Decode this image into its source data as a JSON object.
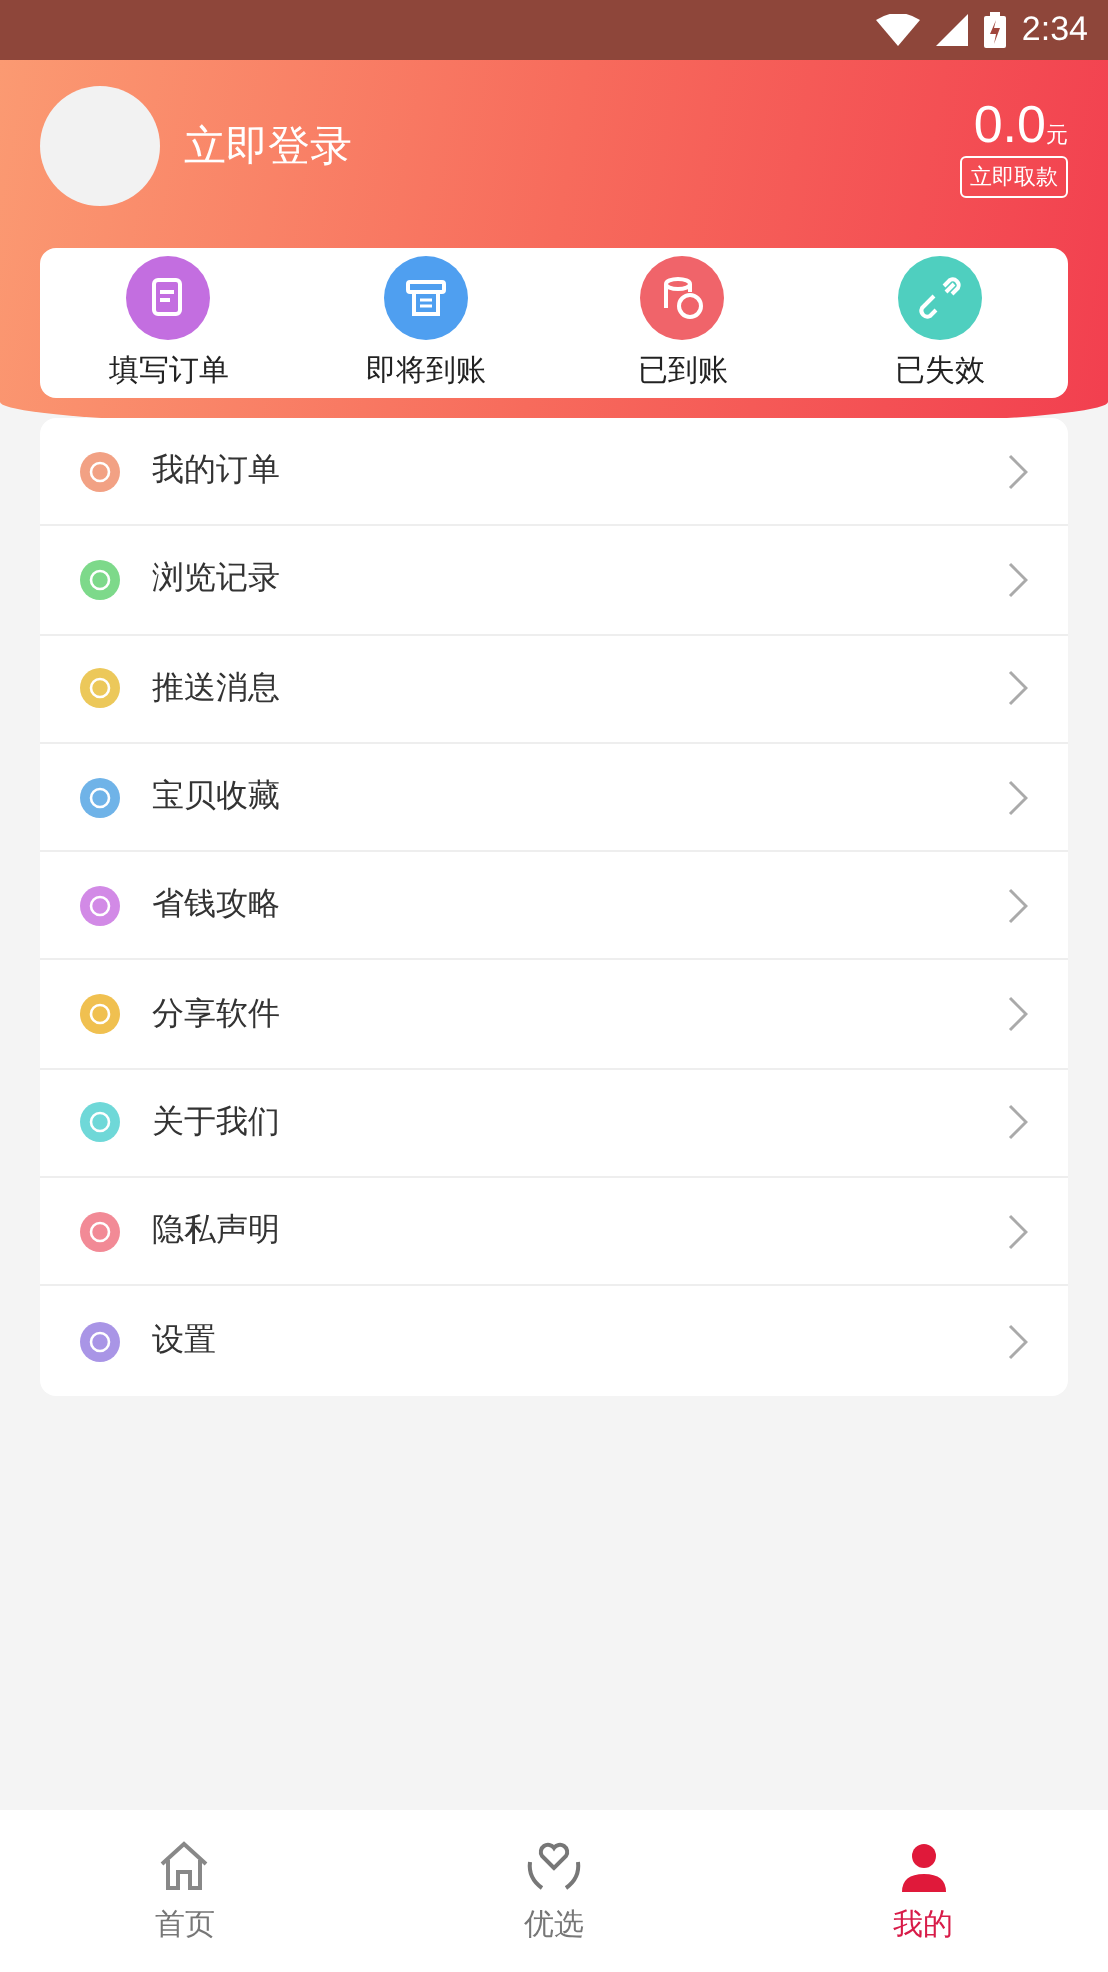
{
  "status_bar": {
    "time": "2:34"
  },
  "profile": {
    "login_label": "立即登录",
    "balance": "0.0",
    "currency": "元",
    "withdraw_button": "立即取款"
  },
  "order_actions": [
    {
      "label": "填写订单",
      "kind": "form",
      "color": "#c36ee0"
    },
    {
      "label": "即将到账",
      "kind": "printer",
      "color": "#4f9ff0"
    },
    {
      "label": "已到账",
      "kind": "coins",
      "color": "#f0646a"
    },
    {
      "label": "已失效",
      "kind": "link",
      "color": "#4fcfbf"
    }
  ],
  "menu_items": [
    {
      "label": "我的订单",
      "color": "#f2a184"
    },
    {
      "label": "浏览记录",
      "color": "#7dd98a"
    },
    {
      "label": "推送消息",
      "color": "#ecc85a"
    },
    {
      "label": "宝贝收藏",
      "color": "#6fb3e8"
    },
    {
      "label": "省钱攻略",
      "color": "#d28ae6"
    },
    {
      "label": "分享软件",
      "color": "#f0c050"
    },
    {
      "label": "关于我们",
      "color": "#6fd8d8"
    },
    {
      "label": "隐私声明",
      "color": "#f28a96"
    },
    {
      "label": "设置",
      "color": "#a995e6"
    }
  ],
  "bottom_nav": [
    {
      "label": "首页",
      "kind": "home",
      "selected": false
    },
    {
      "label": "优选",
      "kind": "heart",
      "selected": false
    },
    {
      "label": "我的",
      "kind": "person",
      "selected": true
    }
  ]
}
